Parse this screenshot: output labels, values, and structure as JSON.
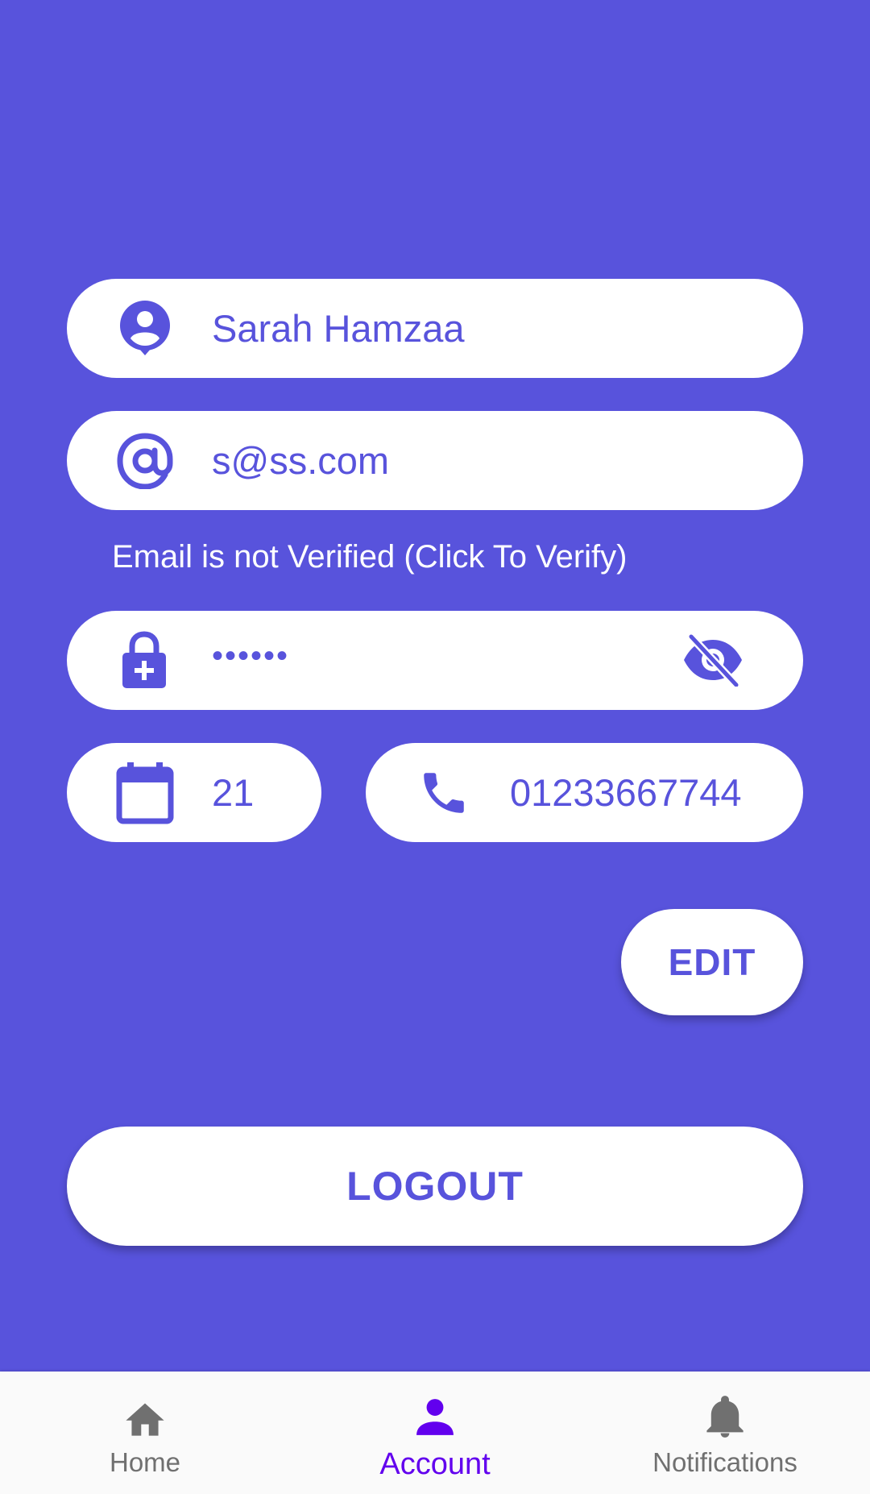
{
  "profile": {
    "name": "Sarah Hamzaa",
    "email": "s@ss.com",
    "email_note": "Email is not Verified (Click To Verify)",
    "password_masked": "••••••",
    "age": "21",
    "phone": "01233667744"
  },
  "icons": {
    "name": "account-circle-icon",
    "email": "at-sign-icon",
    "password": "lock-plus-icon",
    "visibility": "eye-off-icon",
    "age": "calendar-icon",
    "phone": "phone-icon"
  },
  "actions": {
    "edit_label": "EDIT",
    "logout_label": "LOGOUT"
  },
  "bottom_nav": {
    "items": [
      {
        "label": "Home",
        "icon": "home-icon",
        "active": false
      },
      {
        "label": "Account",
        "icon": "person-icon",
        "active": true
      },
      {
        "label": "Notifications",
        "icon": "bell-icon",
        "active": false
      }
    ]
  },
  "colors": {
    "background": "#5853DC",
    "accent": "#5853DC",
    "nav_active": "#6200EE",
    "nav_inactive": "#707070",
    "nav_background": "#FAFAFA"
  }
}
